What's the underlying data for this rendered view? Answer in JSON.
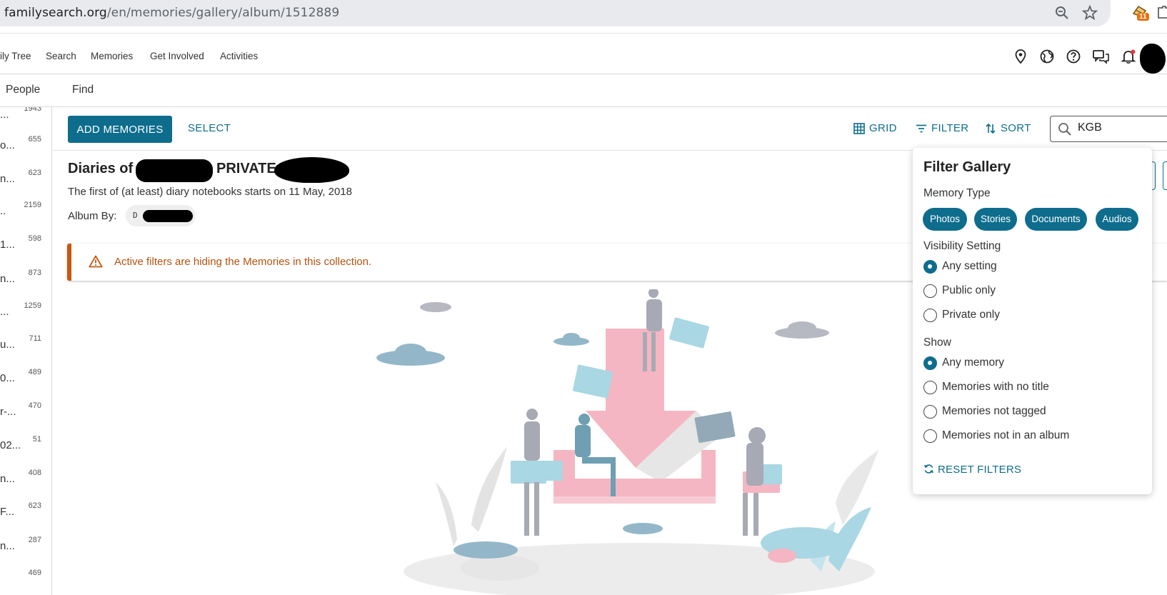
{
  "browser": {
    "url_prefix": "familysearch.org",
    "url_path": "/en/memories/gallery/album/1512889",
    "extension_badge": "11",
    "icons": [
      "zoom-icon",
      "star-icon",
      "extension-icon"
    ]
  },
  "site_nav": {
    "items": [
      "ily Tree",
      "Search",
      "Memories",
      "Get Involved",
      "Activities"
    ],
    "icons": [
      "location-pin-icon",
      "globe-icon",
      "help-icon",
      "chat-icon",
      "bell-icon",
      "avatar"
    ]
  },
  "sub_nav": {
    "items": [
      "People",
      "Find"
    ]
  },
  "album_list": [
    {
      "title": "...",
      "count": "1943"
    },
    {
      "title": "o...",
      "count": "655"
    },
    {
      "title": "n...",
      "count": "623"
    },
    {
      "title": "..",
      "count": "2159"
    },
    {
      "title": "1...",
      "count": "598"
    },
    {
      "title": "n...",
      "count": "873"
    },
    {
      "title": "...",
      "count": "1259"
    },
    {
      "title": "u...",
      "count": "711"
    },
    {
      "title": "0...",
      "count": "489"
    },
    {
      "title": "r-...",
      "count": "470"
    },
    {
      "title": "02...",
      "count": "51"
    },
    {
      "title": "n...",
      "count": "408"
    },
    {
      "title": "F...",
      "count": "623"
    },
    {
      "title": "n...",
      "count": "287"
    },
    {
      "title": "",
      "count": "469"
    }
  ],
  "toolbar": {
    "add_label": "ADD MEMORIES",
    "select_label": "SELECT",
    "grid_label": "GRID",
    "filter_label": "FILTER",
    "sort_label": "SORT",
    "search_value": "KGB"
  },
  "album": {
    "title_start": "Diaries of",
    "title_middle": "PRIVATE",
    "description": "The first of (at least) diary notebooks starts on 11 May, 2018",
    "by_label": "Album By:",
    "by_initial": "D"
  },
  "alert": {
    "message": "Active filters are hiding the Memories in this collection."
  },
  "filter_panel": {
    "title": "Filter Gallery",
    "memory_type_label": "Memory Type",
    "memory_types": [
      "Photos",
      "Stories",
      "Documents",
      "Audios"
    ],
    "visibility_label": "Visibility Setting",
    "visibility_options": [
      "Any setting",
      "Public only",
      "Private only"
    ],
    "visibility_selected": 0,
    "show_label": "Show",
    "show_options": [
      "Any memory",
      "Memories with no title",
      "Memories not tagged",
      "Memories not in an album"
    ],
    "show_selected": 0,
    "reset_label": "RESET FILTERS"
  },
  "colors": {
    "accent": "#0e6d8d",
    "warning": "#c45a12",
    "illustration_pink": "#f4b6c2",
    "illustration_blue": "#a9d7e3"
  }
}
